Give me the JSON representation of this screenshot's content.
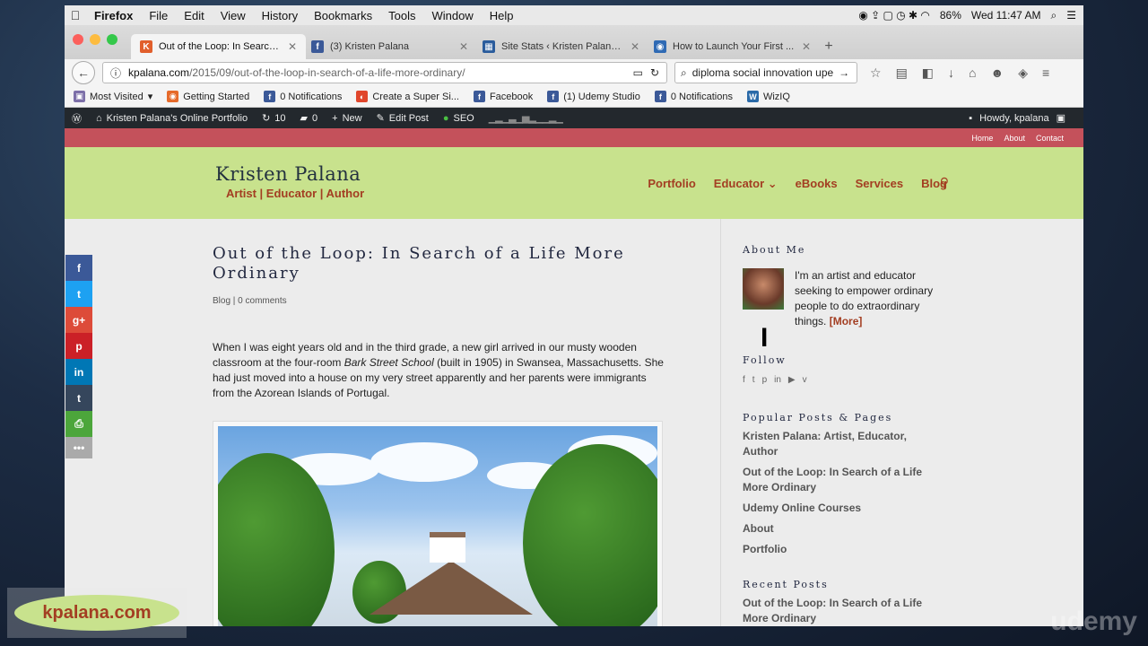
{
  "menubar": {
    "items": [
      "Firefox",
      "File",
      "Edit",
      "View",
      "History",
      "Bookmarks",
      "Tools",
      "Window",
      "Help"
    ],
    "battery": "86%",
    "clock": "Wed 11:47 AM"
  },
  "tabs": [
    {
      "title": "Out of the Loop: In Search...",
      "favicon": "K",
      "color": "#e15f2c",
      "active": true
    },
    {
      "title": "(3) Kristen Palana",
      "favicon": "f",
      "color": "#3b5998",
      "active": false
    },
    {
      "title": "Site Stats ‹ Kristen Palana'...",
      "favicon": "▦",
      "color": "#2a5c9c",
      "active": false
    },
    {
      "title": "How to Launch Your First ...",
      "favicon": "◉",
      "color": "#2f6ab4",
      "active": false
    }
  ],
  "url": {
    "host": "kpalana.com",
    "path": "/2015/09/out-of-the-loop-in-search-of-a-life-more-ordinary/"
  },
  "search_value": "diploma social innovation upe",
  "bookmarks": [
    {
      "label": "Most Visited",
      "color": "#7c6fa8",
      "icon": "▣"
    },
    {
      "label": "Getting Started",
      "color": "#e66a2a",
      "icon": "◉"
    },
    {
      "label": "0 Notifications",
      "color": "#3b5998",
      "icon": "f"
    },
    {
      "label": "Create a Super Si...",
      "color": "#e0462b",
      "icon": "◐"
    },
    {
      "label": "Facebook",
      "color": "#3b5998",
      "icon": "f"
    },
    {
      "label": "(1) Udemy Studio",
      "color": "#3b5998",
      "icon": "f"
    },
    {
      "label": "0 Notifications",
      "color": "#3b5998",
      "icon": "f"
    },
    {
      "label": "WizIQ",
      "color": "#2a6aa8",
      "icon": "W"
    }
  ],
  "wpbar": {
    "site": "Kristen Palana's Online Portfolio",
    "updates": "10",
    "comments": "0",
    "new": "New",
    "edit": "Edit Post",
    "seo": "SEO",
    "howdy": "Howdy, kpalana"
  },
  "top_links": [
    "Home",
    "About",
    "Contact"
  ],
  "site": {
    "name": "Kristen Palana",
    "tagline": "Artist | Educator | Author"
  },
  "nav": [
    "Portfolio",
    "Educator ⌄",
    "eBooks",
    "Services",
    "Blog"
  ],
  "post": {
    "title": "Out of the Loop: In Search of a Life More Ordinary",
    "meta": "Blog | 0 comments",
    "para_before": "When I was eight years old and in the third grade, a new girl arrived in our musty wooden classroom at the four-room ",
    "para_em": "Bark Street School",
    "para_after": " (built in 1905) in Swansea, Massachusetts. She had just moved into a house on my very street apparently and her parents were immigrants from the Azorean Islands of Portugal."
  },
  "sidebar": {
    "about_title": "About Me",
    "about_text": "I'm an artist and educator seeking to empower ordinary people to do extraordinary things.",
    "about_more": "[More]",
    "follow_title": "Follow",
    "social": [
      "f",
      "t",
      "p",
      "in",
      "▶",
      "v"
    ],
    "popular_title": "Popular Posts & Pages",
    "popular": [
      "Kristen Palana: Artist, Educator, Author",
      "Out of the Loop: In Search of a Life More Ordinary",
      "Udemy Online Courses",
      "About",
      "Portfolio"
    ],
    "recent_title": "Recent Posts",
    "recent": [
      "Out of the Loop: In Search of a Life More Ordinary"
    ]
  },
  "share": [
    {
      "icon": "f",
      "color": "#3b5998"
    },
    {
      "icon": "t",
      "color": "#1da1f2"
    },
    {
      "icon": "g+",
      "color": "#dd4b39"
    },
    {
      "icon": "p",
      "color": "#cb2027"
    },
    {
      "icon": "in",
      "color": "#0077b5"
    },
    {
      "icon": "t",
      "color": "#35465c"
    },
    {
      "icon": "⎙",
      "color": "#4ca63b"
    },
    {
      "icon": "•••",
      "color": "#aaa"
    }
  ],
  "brand_overlay": "kpalana.com",
  "watermark": "udemy"
}
